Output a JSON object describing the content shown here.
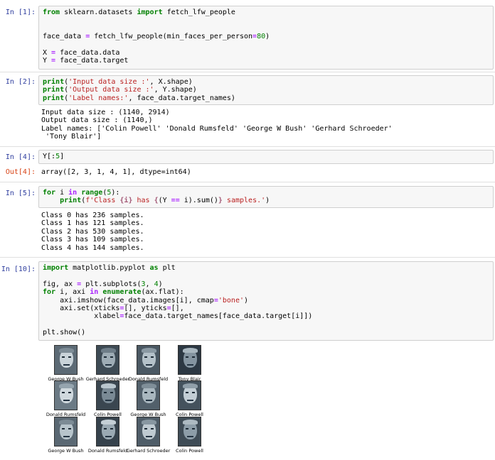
{
  "cells": [
    {
      "prompt": "In [1]:"
    },
    {
      "prompt": "In [2]:",
      "output": "Input data size : (1140, 2914)\nOutput data size : (1140,)\nLabel names: ['Colin Powell' 'Donald Rumsfeld' 'George W Bush' 'Gerhard Schroeder'\n 'Tony Blair']"
    },
    {
      "prompt": "In [4]:",
      "out_prompt": "Out[4]:",
      "output": "array([2, 3, 1, 4, 1], dtype=int64)"
    },
    {
      "prompt": "In [5]:",
      "output": "Class 0 has 236 samples.\nClass 1 has 121 samples.\nClass 2 has 530 samples.\nClass 3 has 109 samples.\nClass 4 has 144 samples."
    },
    {
      "prompt": "In [10]:"
    }
  ],
  "figure_labels": [
    "George W Bush",
    "Gerhard Schroeder",
    "Donald Rumsfeld",
    "Tony Blair",
    "Donald Rumsfeld",
    "Colin Powell",
    "George W Bush",
    "Colin Powell",
    "George W Bush",
    "Donald Rumsfeld",
    "Gerhard Schroeder",
    "Colin Powell"
  ],
  "colors": {
    "input_bg": "#f7f7f7",
    "in_prompt": "#303f9f",
    "out_prompt": "#d84315",
    "keyword": "#008000",
    "string": "#ba2121",
    "operator": "#aa22ff",
    "face_cmap": "bone"
  }
}
